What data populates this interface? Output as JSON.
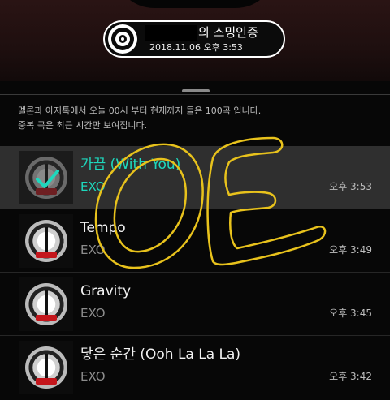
{
  "certification": {
    "title": "의 스밍인증",
    "timestamp": "2018.11.06 오후 3:53"
  },
  "description": {
    "line1": "멜론과 아지톡에서 오늘 00시 부터 현재까지 들은 100곡 입니다.",
    "line2": "중복 곡은 최근 시간만 보여집니다."
  },
  "songs": [
    {
      "title": "가끔 (With You)",
      "artist": "EXO",
      "time": "오후 3:53",
      "selected": true
    },
    {
      "title": "Tempo",
      "artist": "EXO",
      "time": "오후 3:49",
      "selected": false
    },
    {
      "title": "Gravity",
      "artist": "EXO",
      "time": "오후 3:45",
      "selected": false
    },
    {
      "title": "닿은 순간 (Ooh La La La)",
      "artist": "EXO",
      "time": "오후 3:42",
      "selected": false
    }
  ],
  "colors": {
    "accent": "#1ed8bd",
    "scribble": "#e8c21c",
    "album_red": "#c4161c"
  },
  "icons": {
    "disc": "vinyl-disc-icon",
    "check": "check-icon"
  }
}
